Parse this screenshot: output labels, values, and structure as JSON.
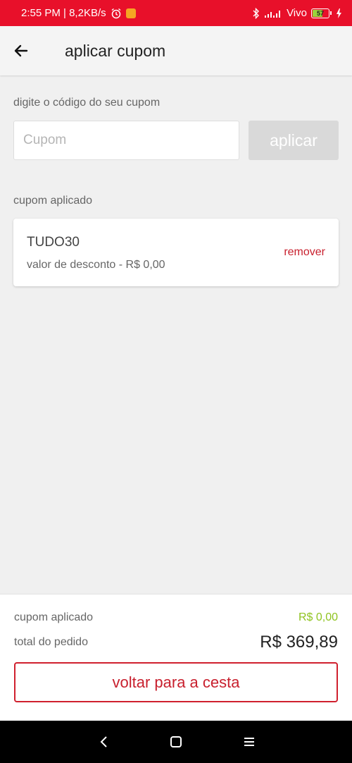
{
  "status_bar": {
    "left_text": "2:55 PM | 8,2KB/s",
    "carrier": "Vivo",
    "battery_level": "57"
  },
  "header": {
    "title": "aplicar cupom"
  },
  "coupon_form": {
    "label": "digite o código do seu cupom",
    "placeholder": "Cupom",
    "apply_label": "aplicar"
  },
  "applied_coupon": {
    "section_label": "cupom aplicado",
    "code": "TUDO30",
    "discount_text": "valor de desconto - R$ 0,00",
    "remove_label": "remover"
  },
  "summary": {
    "coupon_label": "cupom aplicado",
    "coupon_value": "R$ 0,00",
    "total_label": "total do pedido",
    "total_value": "R$ 369,89",
    "back_button_label": "voltar para a cesta"
  },
  "colors": {
    "brand_red": "#e8102a",
    "accent_green": "#8fc31f"
  }
}
